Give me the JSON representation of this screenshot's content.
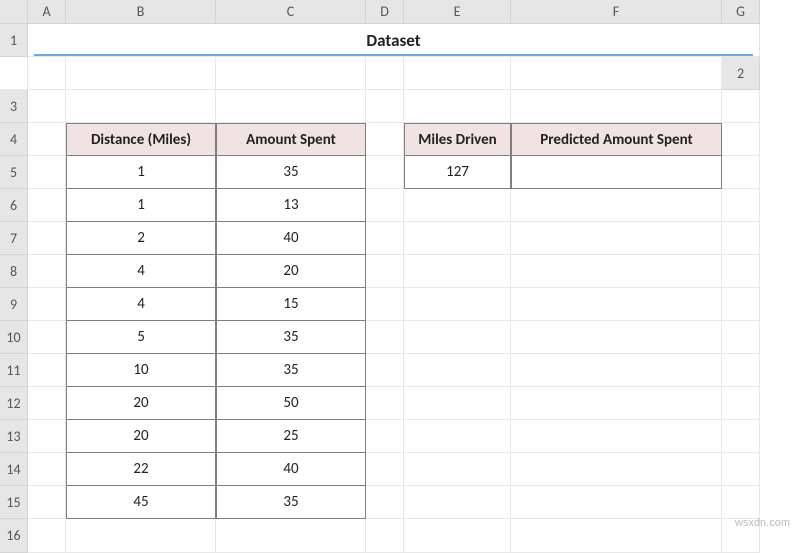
{
  "cols": [
    "",
    "A",
    "B",
    "C",
    "D",
    "E",
    "F",
    "G"
  ],
  "rows": [
    "1",
    "2",
    "3",
    "4",
    "5",
    "6",
    "7",
    "8",
    "9",
    "10",
    "11",
    "12",
    "13",
    "14",
    "15",
    "16"
  ],
  "title": "Dataset",
  "main_table": {
    "headers": [
      "Distance (Miles)",
      "Amount Spent"
    ],
    "rows": [
      [
        "1",
        "35"
      ],
      [
        "1",
        "13"
      ],
      [
        "2",
        "40"
      ],
      [
        "4",
        "20"
      ],
      [
        "4",
        "15"
      ],
      [
        "5",
        "35"
      ],
      [
        "10",
        "35"
      ],
      [
        "20",
        "50"
      ],
      [
        "20",
        "25"
      ],
      [
        "22",
        "40"
      ],
      [
        "45",
        "35"
      ]
    ]
  },
  "side_table": {
    "headers": [
      "Miles Driven",
      "Predicted Amount Spent"
    ],
    "rows": [
      [
        "127",
        ""
      ]
    ]
  },
  "watermark": "wsxdn.com"
}
